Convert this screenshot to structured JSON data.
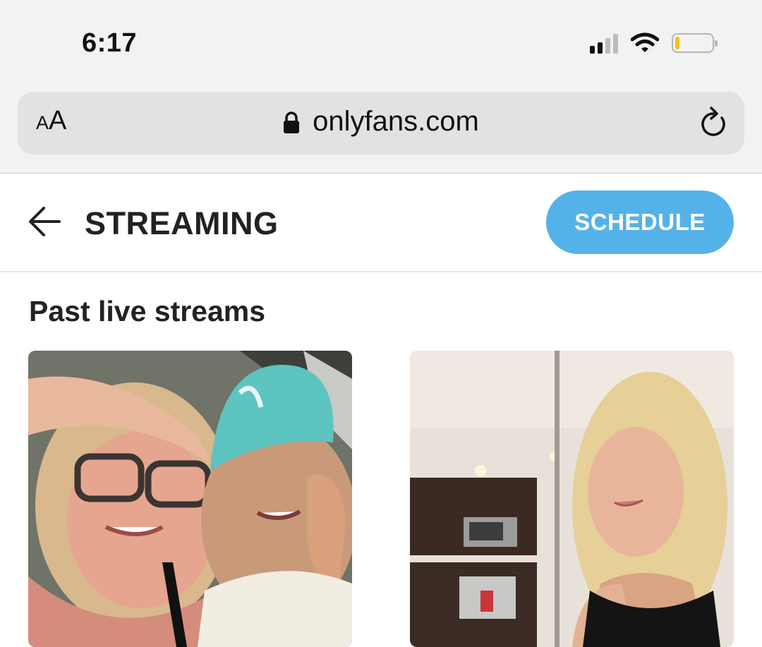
{
  "status_bar": {
    "time": "6:17",
    "icons": [
      "cellular-signal-icon",
      "wifi-icon",
      "battery-icon"
    ],
    "battery_color": "#f4c21c"
  },
  "browser": {
    "text_size_small": "A",
    "text_size_big": "A",
    "url": "onlyfans.com",
    "icons": [
      "lock-icon",
      "reload-icon"
    ]
  },
  "header": {
    "title": "STREAMING",
    "schedule_label": "SCHEDULE",
    "accent": "#55b2e8"
  },
  "section": {
    "title": "Past live streams"
  },
  "streams": [
    {
      "thumbnail": "stream-thumbnail-1"
    },
    {
      "thumbnail": "stream-thumbnail-2"
    }
  ]
}
